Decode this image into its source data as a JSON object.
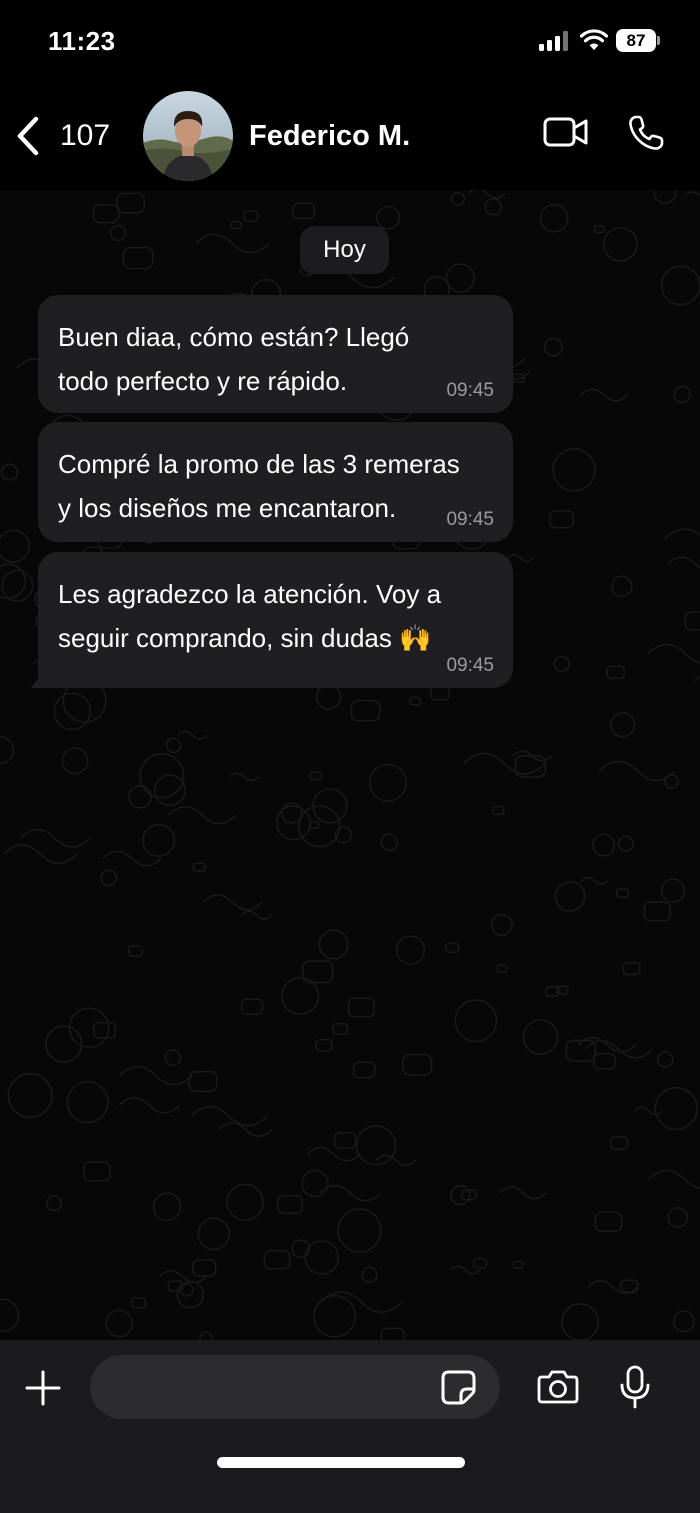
{
  "status_bar": {
    "time": "11:23",
    "battery_level": "87",
    "icons": [
      "signal-icon",
      "wifi-icon",
      "battery-icon"
    ]
  },
  "header": {
    "back_count": "107",
    "contact_name": "Federico M.",
    "icons": [
      "chevron-left-icon",
      "video-camera-icon",
      "phone-icon"
    ]
  },
  "chat": {
    "date_label": "Hoy",
    "messages": [
      {
        "lines": [
          "Buen diaa, cómo están? Llegó",
          "todo perfecto y re rápido."
        ],
        "time": "09:45"
      },
      {
        "lines": [
          "Compré la promo de las 3 remeras",
          "y los diseños me encantaron."
        ],
        "time": "09:45"
      },
      {
        "lines": [
          "Les agradezco la atención. Voy a",
          "seguir comprando, sin dudas 🙌"
        ],
        "time": "09:45"
      }
    ]
  },
  "input": {
    "placeholder": "",
    "icons": [
      "plus-icon",
      "sticker-icon",
      "camera-icon",
      "microphone-icon"
    ]
  },
  "colors": {
    "background": "#000000",
    "bubble": "#1f1f21",
    "input_bar": "#1b1b1d",
    "timestamp": "#9b9b9f"
  }
}
